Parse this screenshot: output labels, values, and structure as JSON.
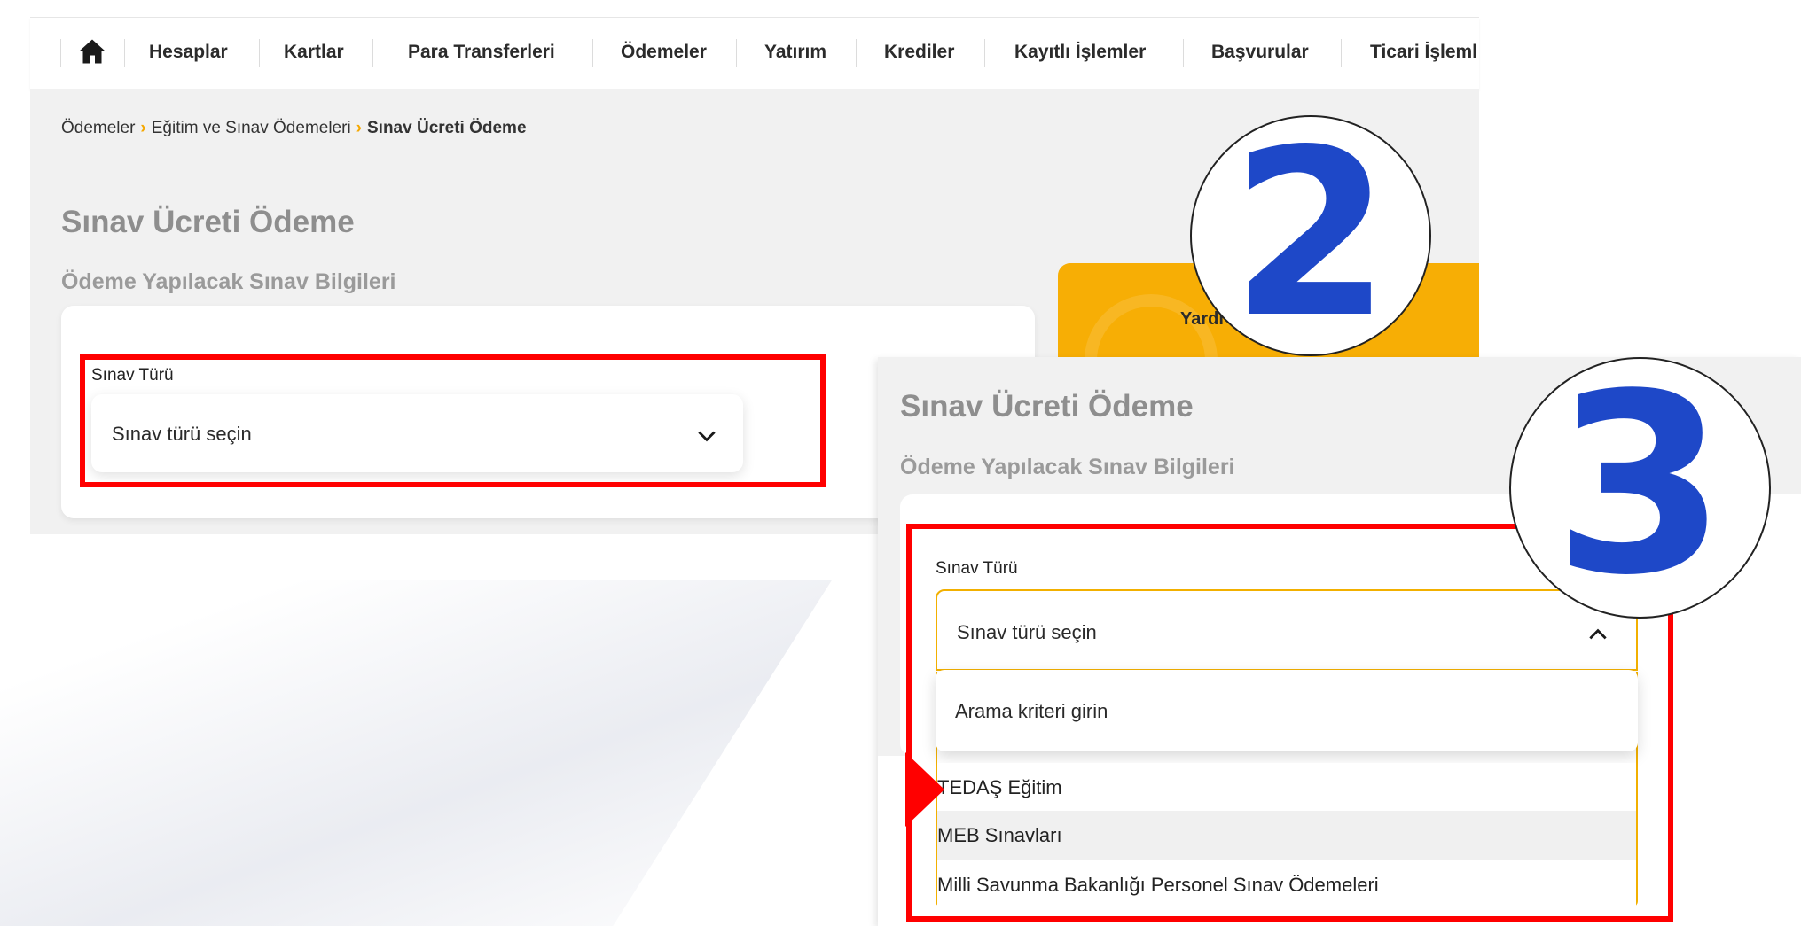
{
  "nav": {
    "items": [
      "Hesaplar",
      "Kartlar",
      "Para Transferleri",
      "Ödemeler",
      "Yatırım",
      "Krediler",
      "Kayıtlı İşlemler",
      "Başvurular",
      "Ticari İşleml"
    ]
  },
  "breadcrumb": {
    "item1": "Ödemeler",
    "item2": "Eğitim ve Sınav Ödemeleri",
    "current": "Sınav Ücreti Ödeme"
  },
  "page": {
    "title": "Sınav Ücreti Ödeme",
    "section": "Ödeme Yapılacak Sınav Bilgileri",
    "field_label": "Sınav Türü",
    "select_placeholder": "Sınav türü seçin"
  },
  "help": {
    "label": "Yardı"
  },
  "badges": {
    "step2": "2",
    "step3": "3"
  },
  "dropdown": {
    "search_placeholder": "Arama kriteri girin",
    "options": [
      "TEDAŞ Eğitim",
      "MEB Sınavları",
      "Milli Savunma Bakanlığı Personel Sınav Ödemeleri"
    ]
  },
  "colors": {
    "accent": "#f7ae05",
    "highlight": "#ff0000",
    "badge_number": "#1e48c8"
  }
}
